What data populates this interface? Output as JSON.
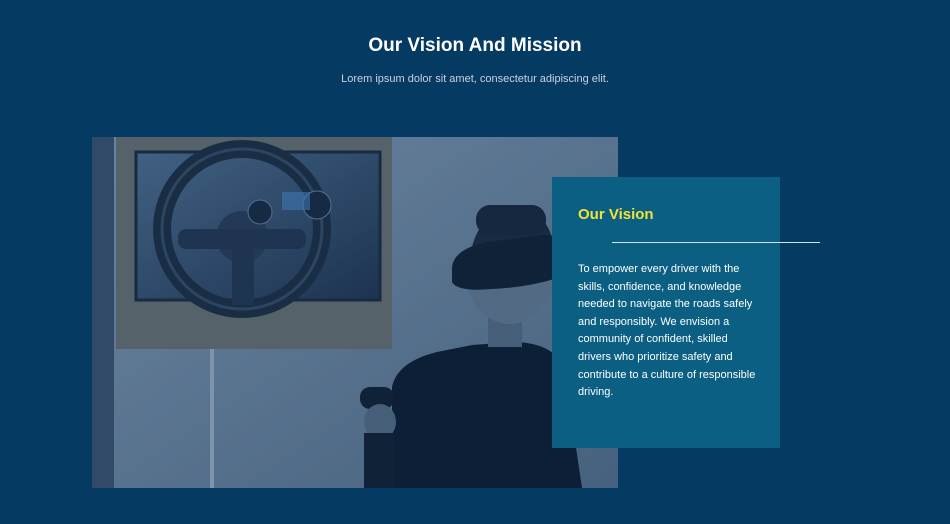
{
  "section": {
    "title": "Our Vision And Mission",
    "subtitle": "Lorem ipsum dolor sit amet, consectetur adipiscing elit."
  },
  "vision": {
    "heading": "Our Vision",
    "body": "To empower every driver with the skills, confidence, and knowledge needed to navigate the roads safely and responsibly. We envision a community of confident, skilled drivers who prioritize safety and contribute to a culture of responsible driving."
  },
  "colors": {
    "background": "#053a63",
    "card": "#0b5f83",
    "accent": "#f0e436",
    "text": "#ffffff"
  }
}
